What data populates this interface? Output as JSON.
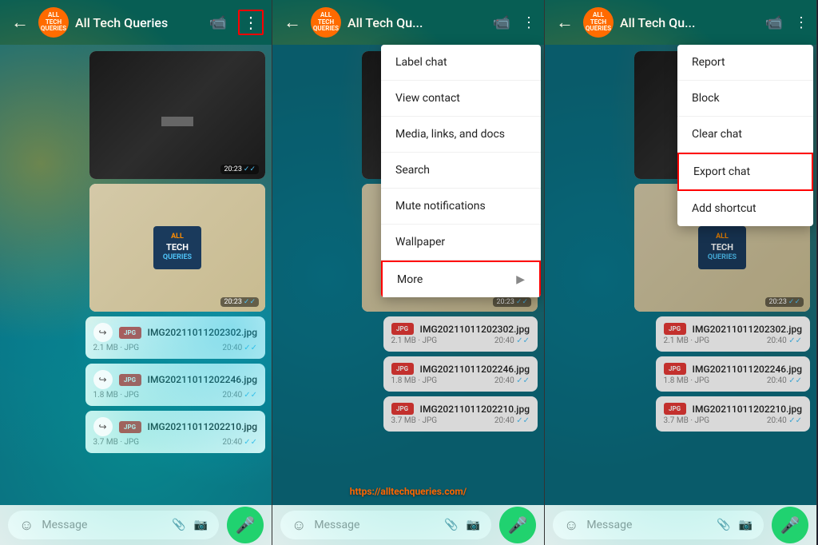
{
  "panels": [
    {
      "id": "panel1",
      "header": {
        "back_label": "←",
        "avatar_text": "ALL\nTECH\nQUERIES",
        "title": "All Tech Queries",
        "icons": [
          "📹",
          "⋮"
        ]
      },
      "messages": [
        {
          "type": "image",
          "style": "dark",
          "timestamp": "20:23",
          "ticks": "✓✓"
        },
        {
          "type": "image",
          "style": "logo",
          "timestamp": "20:23",
          "ticks": "✓✓"
        },
        {
          "type": "file",
          "name": "IMG20211011202302.jpg",
          "size": "2.1 MB",
          "ext": "JPG",
          "timestamp": "20:40",
          "ticks": "✓✓"
        },
        {
          "type": "file",
          "name": "IMG20211011202246.jpg",
          "size": "1.8 MB",
          "ext": "JPG",
          "timestamp": "20:40",
          "ticks": "✓✓"
        },
        {
          "type": "file",
          "name": "IMG20211011202210.jpg",
          "size": "3.7 MB",
          "ext": "JPG",
          "timestamp": "20:40",
          "ticks": "✓✓"
        }
      ],
      "input_placeholder": "Message",
      "show_dots_highlight": true,
      "show_menu": false
    },
    {
      "id": "panel2",
      "header": {
        "title": "All Tech Qu...",
        "avatar_text": "ALL\nTECH\nQUERIES"
      },
      "show_menu": true,
      "menu_items": [
        {
          "label": "Label chat",
          "has_arrow": false
        },
        {
          "label": "View contact",
          "has_arrow": false
        },
        {
          "label": "Media, links, and docs",
          "has_arrow": false
        },
        {
          "label": "Search",
          "has_arrow": false
        },
        {
          "label": "Mute notifications",
          "has_arrow": false
        },
        {
          "label": "Wallpaper",
          "has_arrow": false
        },
        {
          "label": "More",
          "has_arrow": true,
          "highlighted": true
        }
      ]
    },
    {
      "id": "panel3",
      "header": {
        "title": "All Tech Qu...",
        "avatar_text": "ALL\nTECH\nQUERIES"
      },
      "show_menu2": true,
      "menu2_items": [
        {
          "label": "Report",
          "highlighted": false
        },
        {
          "label": "Block",
          "highlighted": false
        },
        {
          "label": "Clear chat",
          "highlighted": false
        },
        {
          "label": "Export chat",
          "highlighted": true
        },
        {
          "label": "Add shortcut",
          "highlighted": false
        }
      ]
    }
  ],
  "watermark": "https://alltechqueries.com/",
  "jpg_badge": "JPG"
}
